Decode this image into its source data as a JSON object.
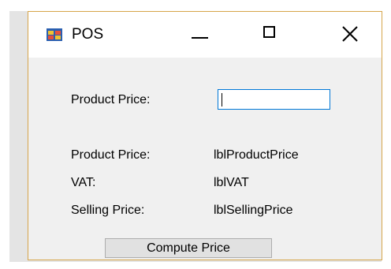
{
  "window": {
    "title": "POS",
    "icon": "form-app-icon",
    "controls": {
      "minimize": "minimize-icon",
      "maximize": "maximize-icon",
      "close": "close-icon"
    }
  },
  "form": {
    "input_label": "Product Price:",
    "input_value": "",
    "rows": [
      {
        "label": "Product Price:",
        "value": "lblProductPrice"
      },
      {
        "label": "VAT:",
        "value": "lblVAT"
      },
      {
        "label": "Selling Price:",
        "value": "lblSellingPrice"
      }
    ],
    "compute_button_label": "Compute Price"
  },
  "colors": {
    "window_border": "#d6a54a",
    "input_focus_border": "#0078d7",
    "form_background": "#f0f0f0",
    "button_face": "#e1e1e1"
  }
}
